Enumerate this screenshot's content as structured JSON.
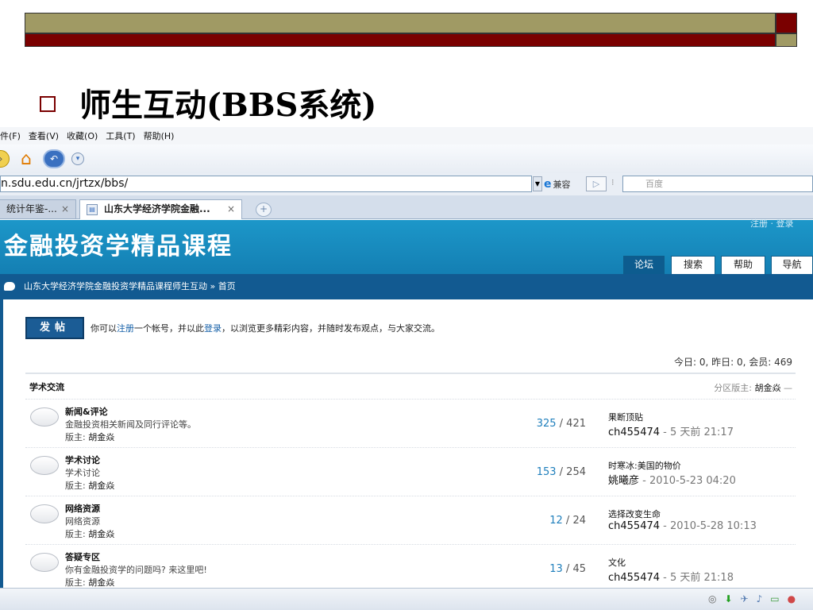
{
  "slide": {
    "title": "师生互动(BBS系统)",
    "colors": {
      "olive": "#a09a64",
      "maroon": "#7a0000"
    }
  },
  "browser": {
    "menu": [
      "件(F)",
      "查看(V)",
      "收藏(O)",
      "工具(T)",
      "帮助(H)"
    ],
    "address": "n.sdu.edu.cn/jrtzx/bbs/",
    "compat_label": "兼容",
    "search_placeholder": "百度",
    "tabs": [
      {
        "label": "统计年鉴-...",
        "close": "×"
      },
      {
        "label": "山东大学经济学院金融...",
        "close": "×"
      }
    ],
    "new_tab": "+"
  },
  "forum": {
    "logo": "金融投资学精品课程",
    "top_links": "注册 · 登录",
    "nav_tabs": [
      "论坛",
      "搜索",
      "帮助",
      "导航"
    ],
    "breadcrumb": "山东大学经济学院金融投资学精品课程师生互动 » 首页",
    "post_button": "发帖",
    "notice": {
      "part1": "你可以",
      "link1": "注册",
      "part2": "一个帐号，并以此",
      "link2": "登录",
      "part3": "，以浏览更多精彩内容，并随时发布观点，与大家交流。"
    },
    "stats": "今日: 0, 昨日: 0, 会员: 469",
    "section": {
      "title": "学术交流",
      "moderator_label": "分区版主:",
      "moderator": "胡金焱",
      "moderator_suffix": "—"
    },
    "moderator_prefix": "版主:",
    "rows": [
      {
        "name": "新闻&评论",
        "desc": "金融投资相关新闻及同行评论等。",
        "moderator": "胡金焱",
        "topics": "325",
        "posts": "421",
        "last_title": "果断顶贴",
        "last_user": "ch455474",
        "last_time": "- 5 天前 21:17"
      },
      {
        "name": "学术讨论",
        "desc": "学术讨论",
        "moderator": "胡金焱",
        "topics": "153",
        "posts": "254",
        "last_title": "时寒冰:美国的物价",
        "last_user": "姚曦彦",
        "last_time": " - 2010-5-23 04:20"
      },
      {
        "name": "网络资源",
        "desc": "网络资源",
        "moderator": "胡金焱",
        "topics": "12",
        "posts": "24",
        "last_title": "选择改变生命",
        "last_user": "ch455474",
        "last_time": "- 2010-5-28 10:13"
      },
      {
        "name": "答疑专区",
        "desc": "你有金融投资学的问题吗? 来这里吧!",
        "moderator": "胡金焱",
        "topics": "13",
        "posts": "45",
        "last_title": "文化",
        "last_user": "ch455474",
        "last_time": "- 5 天前 21:18"
      }
    ]
  }
}
